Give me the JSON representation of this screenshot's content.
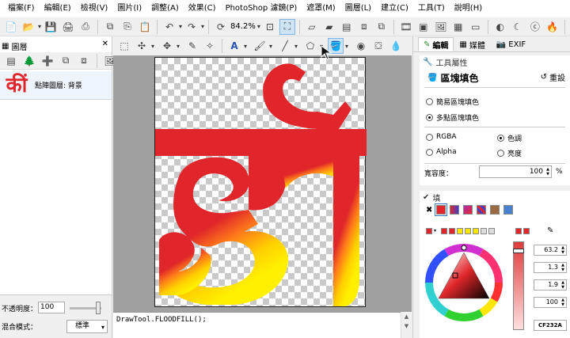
{
  "menu": [
    "檔案(F)",
    "編輯(E)",
    "檢視(V)",
    "圖片(I)",
    "調整(A)",
    "效果(C)",
    "PhotoShop 濾鏡(P)",
    "遮罩(M)",
    "圖層(L)",
    "建立(C)",
    "工具(T)",
    "說明(H)"
  ],
  "toolbar": {
    "zoom": "84.2%"
  },
  "layers_panel": {
    "tab_label": "圖層",
    "layer_thumb": "कीं",
    "layer_name": "點陣圖層: 背景",
    "opacity_label": "不透明度：",
    "opacity_value": "100",
    "blend_label": "混合模式：",
    "blend_value": "標準"
  },
  "console": {
    "text": "DrawTool.FLOODFILL();"
  },
  "right_panel": {
    "tabs": [
      "編輯",
      "媒體",
      "EXIF"
    ],
    "tool_props_header": "工具屬性",
    "tool_title": "區塊填色",
    "reset_label": "重設",
    "mode_simple": "簡易區塊填色",
    "mode_multi": "多點區塊填色",
    "opt_rgba": "RGBA",
    "opt_hue": "色調",
    "opt_alpha": "Alpha",
    "opt_brightness": "亮度",
    "tolerance_label": "寬容度：",
    "tolerance_value": "100",
    "tolerance_unit": "%",
    "fill_header": "填",
    "values": [
      "63.2",
      "1.3",
      "1.9",
      "100"
    ],
    "hex": "CF232A"
  },
  "colors": {
    "accent": "#e0262a",
    "yellow": "#ffe600",
    "orange": "#ff8c1a"
  }
}
